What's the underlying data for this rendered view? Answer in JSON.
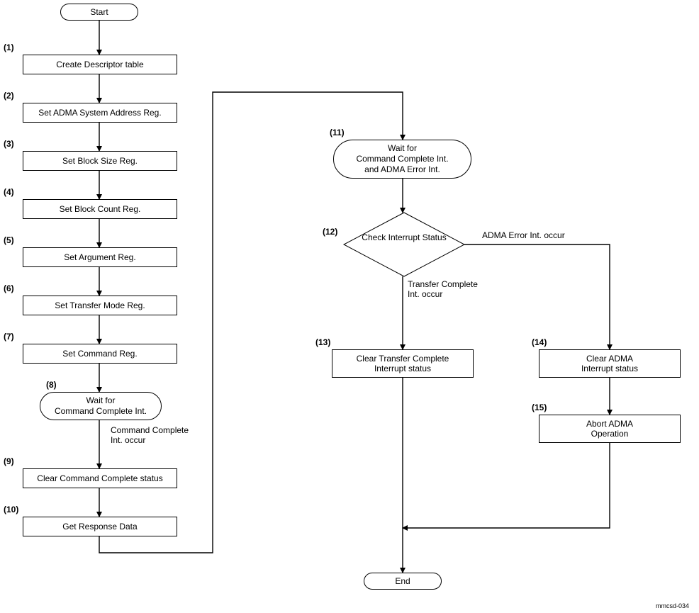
{
  "nodes": {
    "start": "Start",
    "end": "End",
    "s1": "Create Descriptor table",
    "s2": "Set ADMA System Address Reg.",
    "s3": "Set Block Size Reg.",
    "s4": "Set Block Count Reg.",
    "s5": "Set Argument Reg.",
    "s6": "Set Transfer Mode Reg.",
    "s7": "Set Command Reg.",
    "s8": "Wait for\nCommand Complete Int.",
    "s9": "Clear Command Complete status",
    "s10": "Get Response Data",
    "s11": "Wait for\nCommand Complete Int.\nand ADMA Error Int.",
    "s12": "Check\nInterrupt Status",
    "s13": "Clear Transfer Complete\nInterrupt status",
    "s14": "Clear ADMA\nInterrupt status",
    "s15": "Abort ADMA\nOperation"
  },
  "stepnums": {
    "n1": "(1)",
    "n2": "(2)",
    "n3": "(3)",
    "n4": "(4)",
    "n5": "(5)",
    "n6": "(6)",
    "n7": "(7)",
    "n8": "(8)",
    "n9": "(9)",
    "n10": "(10)",
    "n11": "(11)",
    "n12": "(12)",
    "n13": "(13)",
    "n14": "(14)",
    "n15": "(15)"
  },
  "edge_labels": {
    "cmd_complete": "Command Complete\nInt. occur",
    "transfer_complete": "Transfer Complete\nInt. occur",
    "adma_error": "ADMA Error Int. occur"
  },
  "footer": "mmcsd-034"
}
